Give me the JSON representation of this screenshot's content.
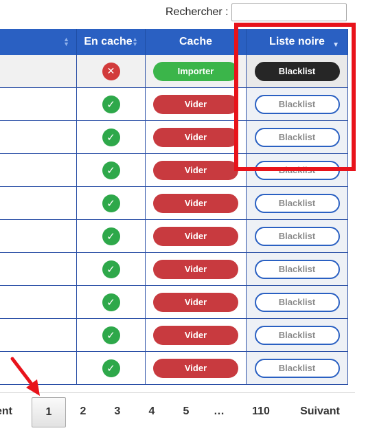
{
  "search": {
    "label": "Rechercher :",
    "value": ""
  },
  "table": {
    "headers": {
      "col1": "",
      "col2": "En cache",
      "col3": "Cache",
      "col4": "Liste noire"
    },
    "rows": [
      {
        "cached": false,
        "cache_action": "Importer",
        "blacklist": "Blacklist",
        "blacklisted": true
      },
      {
        "cached": true,
        "cache_action": "Vider",
        "blacklist": "Blacklist",
        "blacklisted": false
      },
      {
        "cached": true,
        "cache_action": "Vider",
        "blacklist": "Blacklist",
        "blacklisted": false
      },
      {
        "cached": true,
        "cache_action": "Vider",
        "blacklist": "Blacklist",
        "blacklisted": false
      },
      {
        "cached": true,
        "cache_action": "Vider",
        "blacklist": "Blacklist",
        "blacklisted": false
      },
      {
        "cached": true,
        "cache_action": "Vider",
        "blacklist": "Blacklist",
        "blacklisted": false
      },
      {
        "cached": true,
        "cache_action": "Vider",
        "blacklist": "Blacklist",
        "blacklisted": false
      },
      {
        "cached": true,
        "cache_action": "Vider",
        "blacklist": "Blacklist",
        "blacklisted": false
      },
      {
        "cached": true,
        "cache_action": "Vider",
        "blacklist": "Blacklist",
        "blacklisted": false
      },
      {
        "cached": true,
        "cache_action": "Vider",
        "blacklist": "Blacklist",
        "blacklisted": false
      }
    ]
  },
  "pagination": {
    "previous": "ent",
    "pages": [
      "1",
      "2",
      "3",
      "4",
      "5",
      "…",
      "110"
    ],
    "current": "1",
    "next": "Suivant"
  },
  "colors": {
    "header": "#2a60c2",
    "vider": "#c83a3f",
    "importer": "#3bb54a",
    "highlight": "#e8131b",
    "arrow": "#e8131b"
  },
  "icons": {
    "cached_ok": "check-circle-icon",
    "cached_no": "x-circle-icon",
    "sort": "sort-icon"
  }
}
